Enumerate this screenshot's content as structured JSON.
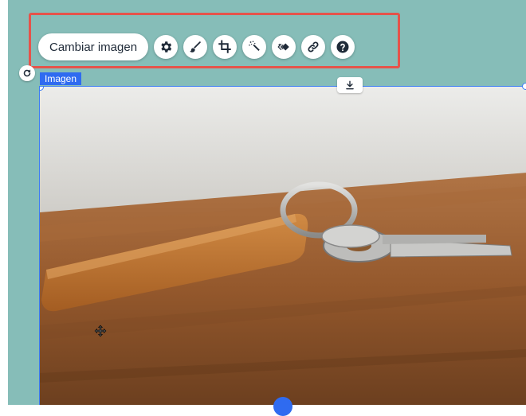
{
  "toolbar": {
    "change_image_label": "Cambiar imagen",
    "icons": [
      "settings-icon",
      "brush-icon",
      "crop-icon",
      "magic-wand-icon",
      "animation-icon",
      "link-icon",
      "help-icon"
    ]
  },
  "element": {
    "tag_label": "Imagen"
  },
  "colors": {
    "canvas_bg": "#86bdb8",
    "highlight": "#e5534b",
    "selection": "#3b7cf5",
    "tag_bg": "#2f6bf0",
    "icon_dark": "#1f2a38"
  }
}
